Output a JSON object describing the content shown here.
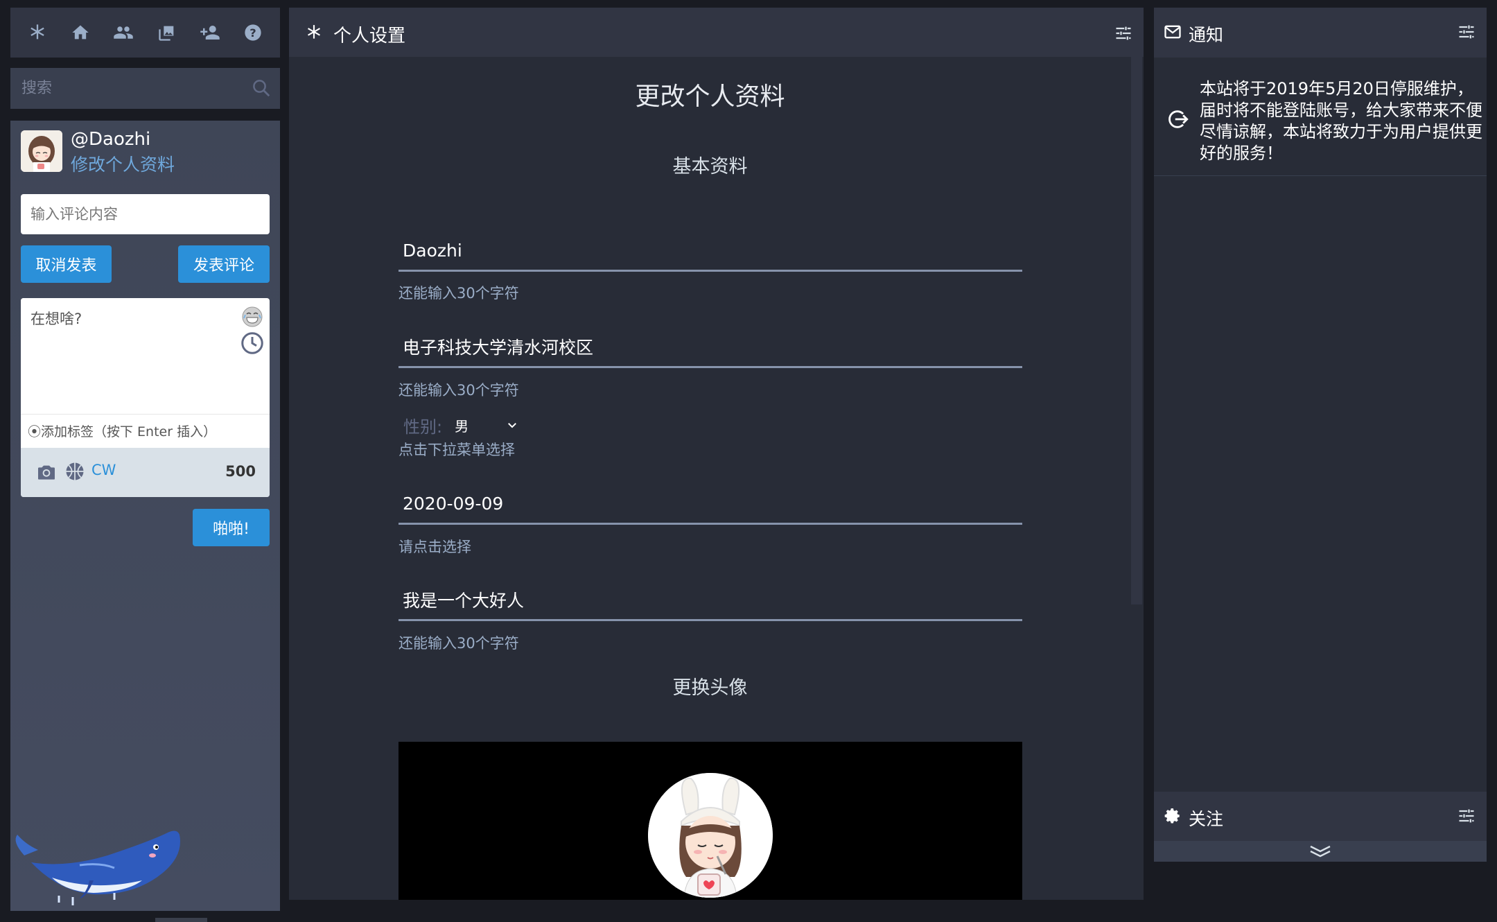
{
  "nav": {
    "items": [
      "getting-started",
      "home",
      "local",
      "media",
      "follow-requests",
      "help"
    ]
  },
  "search": {
    "placeholder": "搜索"
  },
  "profile": {
    "name": "@Daozhi",
    "edit_link": "修改个人资料"
  },
  "comment": {
    "placeholder": "输入评论内容",
    "cancel_label": "取消发表",
    "post_label": "发表评论"
  },
  "compose": {
    "placeholder": "在想啥?",
    "tag_hint": "⦿添加标签（按下 Enter 插入）",
    "cw_label": "CW",
    "char_count": "500",
    "toot_label": "啪啪!"
  },
  "settings": {
    "header_title": "个人设置",
    "page_title": "更改个人资料",
    "basic_section": "基本资料",
    "display_name": "Daozhi",
    "display_name_hint": "还能输入30个字符",
    "school": "电子科技大学清水河校区",
    "school_hint": "还能输入30个字符",
    "gender_label": "性别:",
    "gender_value": "男",
    "gender_hint": "点击下拉菜单选择",
    "birthday": "2020-09-09",
    "birthday_hint": "请点击选择",
    "bio": "我是一个大好人",
    "bio_hint": "还能输入30个字符",
    "avatar_section": "更换头像"
  },
  "notifications": {
    "title": "通知",
    "message": "本站将于2019年5月20日停服维护，届时将不能登陆账号，给大家带来不便尽情谅解，本站将致力于为用户提供更好的服务！"
  },
  "follow": {
    "title": "关注"
  },
  "colors": {
    "accent": "#2b90d9",
    "panel": "#313543",
    "body": "#282c37",
    "background": "#191b22",
    "link": "#6fa8dc"
  }
}
